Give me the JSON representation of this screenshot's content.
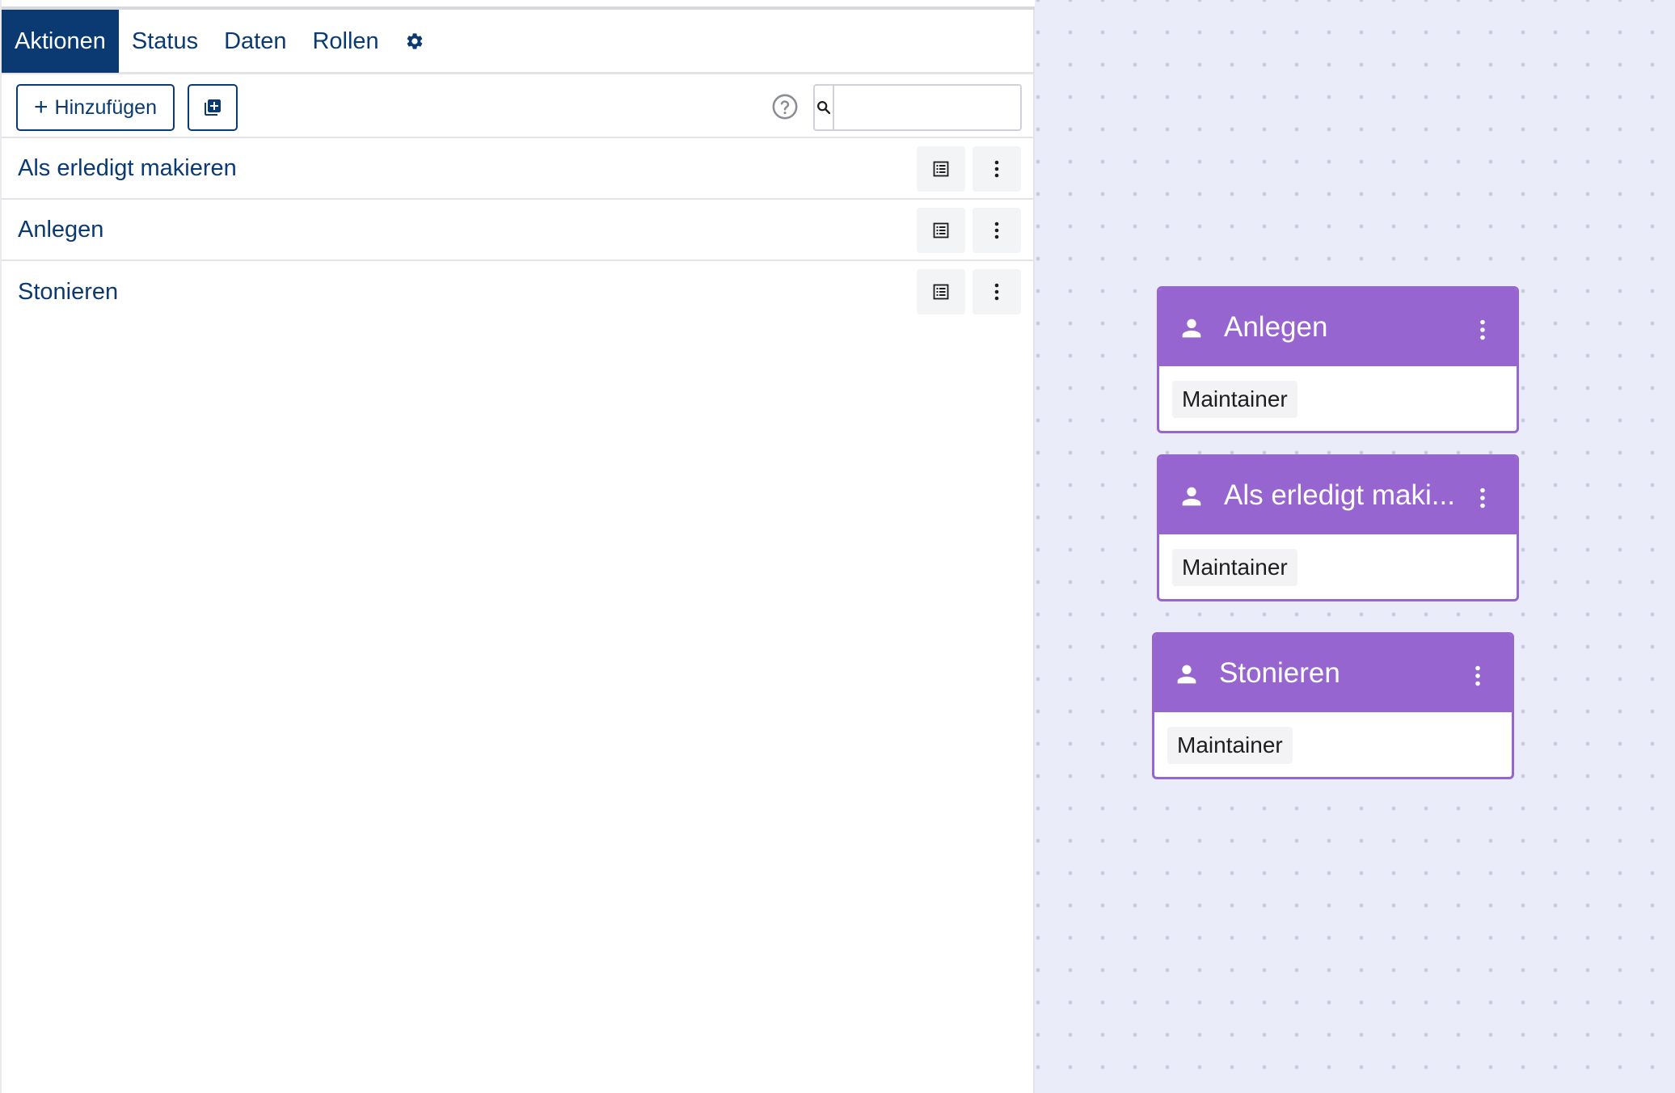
{
  "tabs": [
    {
      "label": "Aktionen",
      "active": true
    },
    {
      "label": "Status",
      "active": false
    },
    {
      "label": "Daten",
      "active": false
    },
    {
      "label": "Rollen",
      "active": false
    }
  ],
  "tab_settings_icon": "gear-icon",
  "toolbar": {
    "add_label": "Hinzufügen",
    "add_icon": "plus-icon",
    "duplicate_icon": "add-copy-icon",
    "help_icon": "help-circle-icon",
    "search_icon": "search-icon",
    "search_value": ""
  },
  "actions": [
    {
      "label": "Als erledigt makieren"
    },
    {
      "label": "Anlegen"
    },
    {
      "label": "Stonieren"
    }
  ],
  "row_icons": {
    "detail": "list-detail-icon",
    "more": "more-vertical-icon"
  },
  "diagram": {
    "cards": [
      {
        "title": "Anlegen",
        "role": "Maintainer"
      },
      {
        "title": "Als erledigt maki...",
        "role": "Maintainer"
      },
      {
        "title": "Stonieren",
        "role": "Maintainer"
      }
    ],
    "card_icon": "person-icon"
  },
  "colors": {
    "primary": "#0b3a72",
    "card_accent": "#9765cf",
    "canvas_background": "#eaecf9"
  }
}
